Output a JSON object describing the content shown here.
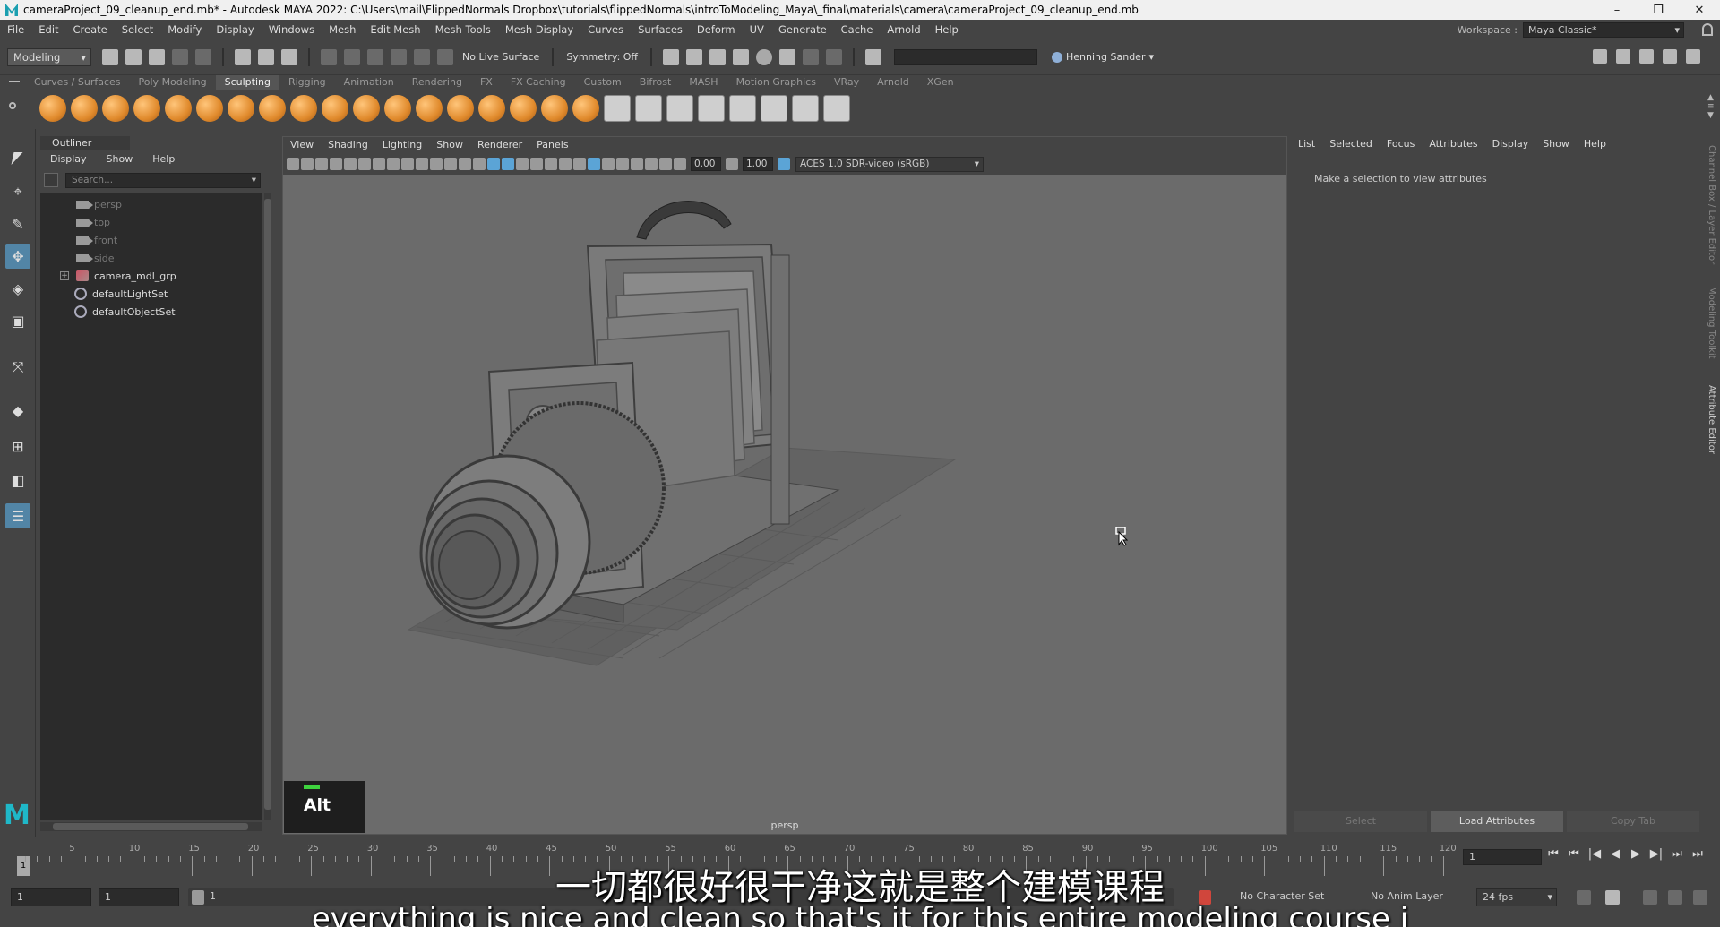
{
  "window": {
    "title": "cameraProject_09_cleanup_end.mb* - Autodesk MAYA 2022: C:\\Users\\mail\\FlippedNormals Dropbox\\tutorials\\flippedNormals\\introToModeling_Maya\\_final\\materials\\camera\\cameraProject_09_cleanup_end.mb",
    "controls": [
      "–",
      "❐",
      "✕"
    ]
  },
  "menubar": [
    "File",
    "Edit",
    "Create",
    "Select",
    "Modify",
    "Display",
    "Windows",
    "Mesh",
    "Edit Mesh",
    "Mesh Tools",
    "Mesh Display",
    "Curves",
    "Surfaces",
    "Deform",
    "UV",
    "Generate",
    "Cache",
    "Arnold",
    "Help"
  ],
  "workspace": {
    "label": "Workspace :",
    "value": "Maya Classic*"
  },
  "statusline": {
    "mode": "Modeling",
    "live_surface": "No Live Surface",
    "symmetry": "Symmetry: Off",
    "user": "Henning Sander"
  },
  "shelf": {
    "tabs": [
      "Curves / Surfaces",
      "Poly Modeling",
      "Sculpting",
      "Rigging",
      "Animation",
      "Rendering",
      "FX",
      "FX Caching",
      "Custom",
      "Bifrost",
      "MASH",
      "Motion Graphics",
      "VRay",
      "Arnold",
      "XGen"
    ],
    "active_tab": "Sculpting"
  },
  "outliner": {
    "title": "Outliner",
    "menu": [
      "Display",
      "Show",
      "Help"
    ],
    "search_placeholder": "Search...",
    "items": [
      {
        "label": "persp",
        "type": "camera",
        "dim": true
      },
      {
        "label": "top",
        "type": "camera",
        "dim": true
      },
      {
        "label": "front",
        "type": "camera",
        "dim": true
      },
      {
        "label": "side",
        "type": "camera",
        "dim": true
      },
      {
        "label": "camera_mdl_grp",
        "type": "group",
        "dim": false
      },
      {
        "label": "defaultLightSet",
        "type": "set",
        "dim": false
      },
      {
        "label": "defaultObjectSet",
        "type": "set",
        "dim": false
      }
    ]
  },
  "viewport": {
    "menu": [
      "View",
      "Shading",
      "Lighting",
      "Show",
      "Renderer",
      "Panels"
    ],
    "exposure": "0.00",
    "gamma": "1.00",
    "color_space": "ACES 1.0 SDR-video (sRGB)",
    "camera_label": "persp",
    "key_badge": "Alt"
  },
  "attribute_editor": {
    "menu": [
      "List",
      "Selected",
      "Focus",
      "Attributes",
      "Display",
      "Show",
      "Help"
    ],
    "message": "Make a selection to view attributes",
    "buttons": [
      "Select",
      "Load Attributes",
      "Copy Tab"
    ],
    "side_tabs": [
      "Channel Box / Layer Editor",
      "Modeling Toolkit",
      "Attribute Editor"
    ]
  },
  "timeslider": {
    "ticks": [
      "5",
      "10",
      "15",
      "20",
      "25",
      "30",
      "35",
      "40",
      "45",
      "50",
      "55",
      "60",
      "65",
      "70",
      "75",
      "80",
      "85",
      "90",
      "95",
      "100",
      "105",
      "110",
      "115",
      "120"
    ],
    "current_frame": "1",
    "frame_field": "1",
    "playback_icons": [
      "⏮",
      "⏮",
      "|◀",
      "◀",
      "▶",
      "▶|",
      "⏭",
      "⏭"
    ]
  },
  "rangebar": {
    "start": "1",
    "playback_start": "1",
    "range_label": "1",
    "character_set": "No Character Set",
    "anim_layer": "No Anim Layer",
    "fps": "24 fps"
  },
  "subtitles": {
    "cn": "一切都很好很干净这就是整个建模课程",
    "en": "everything is nice and clean so that's it for this entire modeling course i"
  }
}
